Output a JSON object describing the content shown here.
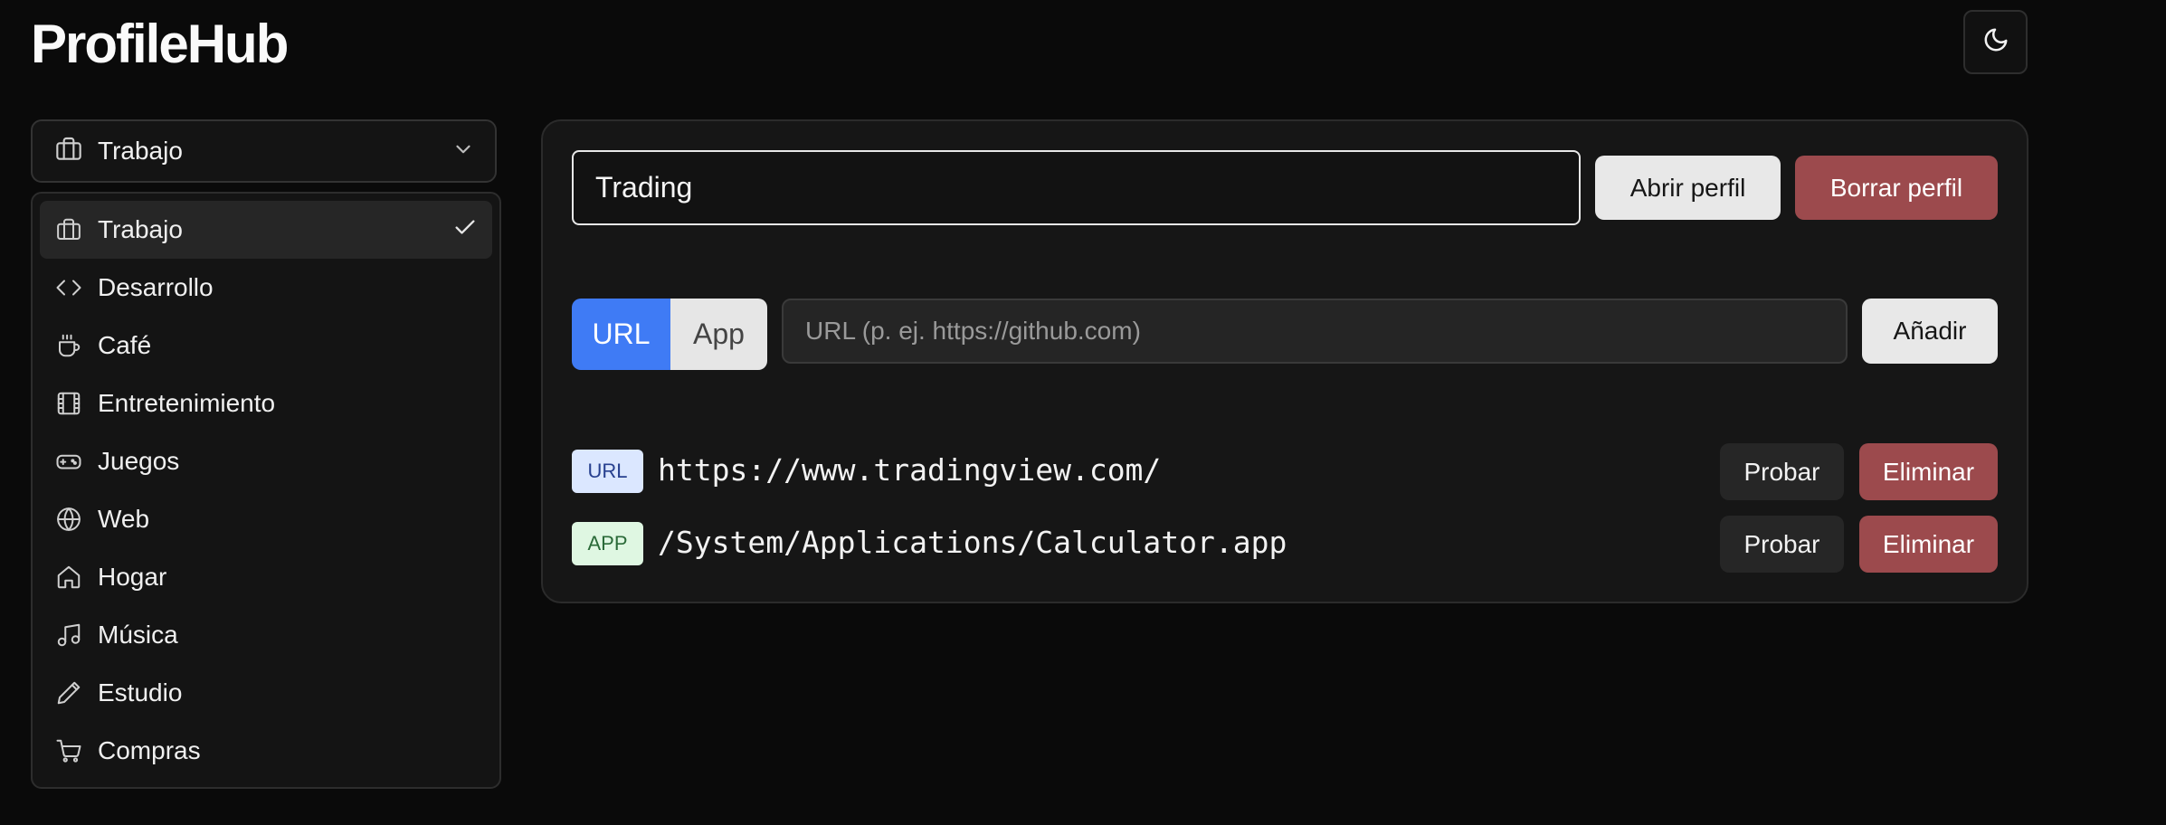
{
  "app": {
    "title": "ProfileHub"
  },
  "header": {
    "theme_toggle_icon": "moon-icon"
  },
  "profile_select": {
    "selected_label": "Trabajo",
    "selected_icon": "briefcase-icon",
    "options": [
      {
        "label": "Trabajo",
        "icon": "briefcase-icon",
        "selected": true
      },
      {
        "label": "Desarrollo",
        "icon": "code-icon"
      },
      {
        "label": "Café",
        "icon": "coffee-icon"
      },
      {
        "label": "Entretenimiento",
        "icon": "film-icon"
      },
      {
        "label": "Juegos",
        "icon": "gamepad-icon"
      },
      {
        "label": "Web",
        "icon": "globe-icon"
      },
      {
        "label": "Hogar",
        "icon": "home-icon"
      },
      {
        "label": "Música",
        "icon": "music-icon"
      },
      {
        "label": "Estudio",
        "icon": "pencil-icon"
      },
      {
        "label": "Compras",
        "icon": "cart-icon"
      }
    ]
  },
  "profile": {
    "name_value": "Trading",
    "open_label": "Abrir perfil",
    "delete_label": "Borrar perfil"
  },
  "add_entry": {
    "type_options": [
      "URL",
      "App"
    ],
    "selected_type": "URL",
    "placeholder": "URL (p. ej. https://github.com)",
    "add_label": "Añadir"
  },
  "entries": [
    {
      "type": "URL",
      "path": "https://www.tradingview.com/",
      "test_label": "Probar",
      "remove_label": "Eliminar"
    },
    {
      "type": "APP",
      "path": "/System/Applications/Calculator.app",
      "test_label": "Probar",
      "remove_label": "Eliminar"
    }
  ],
  "colors": {
    "background": "#0a0a0a",
    "panel": "#161616",
    "accent_blue": "#3f7bf5",
    "danger": "#9c4a4d",
    "url_badge": "#dbe7ff",
    "app_badge": "#dff7e2"
  }
}
